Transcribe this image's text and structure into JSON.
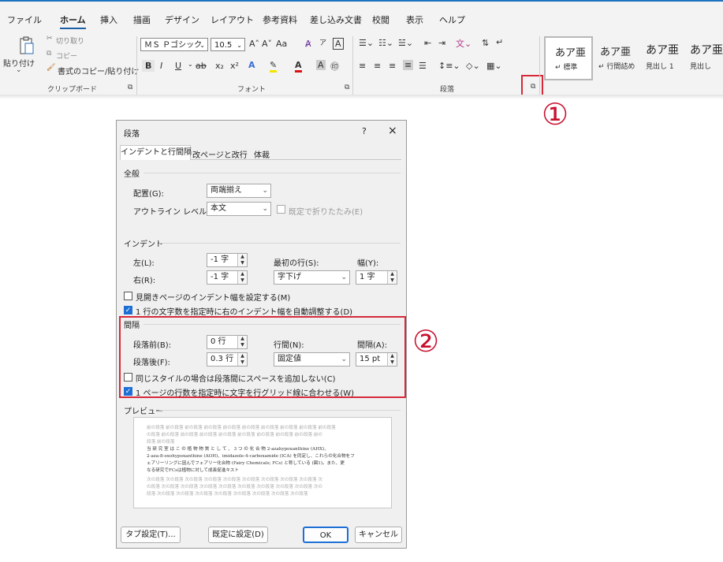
{
  "ribbon": {
    "tabs": [
      "ファイル",
      "ホーム",
      "挿入",
      "描画",
      "デザイン",
      "レイアウト",
      "参考資料",
      "差し込み文書",
      "校閲",
      "表示",
      "ヘルプ"
    ],
    "active_tab": "ホーム",
    "clipboard": {
      "paste": "貼り付け",
      "cut": "切り取り",
      "copy": "コピー",
      "format_painter": "書式のコピー/貼り付け",
      "group": "クリップボード"
    },
    "font": {
      "name": "ＭＳ Ｐゴシック",
      "size": "10.5",
      "group": "フォント",
      "aa": "Aa",
      "bold": "B",
      "italic": "I",
      "underline": "U",
      "strike": "ab",
      "sub": "x₂",
      "sup": "x²"
    },
    "paragraph": {
      "group": "段落"
    },
    "styles": [
      {
        "sample": "あア亜",
        "name": "↵ 標準"
      },
      {
        "sample": "あア亜",
        "name": "↵ 行間詰め"
      },
      {
        "sample": "あア亜",
        "name": "見出し 1"
      },
      {
        "sample": "あア亜",
        "name": "見出し"
      }
    ]
  },
  "callouts": {
    "one": "①",
    "two": "②"
  },
  "dialog": {
    "title": "段落",
    "help": "?",
    "close": "×",
    "tabs": [
      "インデントと行間隔",
      "改ページと改行",
      "体裁"
    ],
    "general": {
      "heading": "全般",
      "alignment_label": "配置(G):",
      "alignment_value": "両端揃え",
      "outline_label": "アウトライン レベル(O):",
      "outline_value": "本文",
      "collapse_label": "既定で折りたたみ(E)"
    },
    "indent": {
      "heading": "インデント",
      "left_label": "左(L):",
      "left_value": "-1 字",
      "right_label": "右(R):",
      "right_value": "-1 字",
      "first_line_label": "最初の行(S):",
      "first_line_value": "字下げ",
      "width_label": "幅(Y):",
      "width_value": "1 字",
      "mirror_label": "見開きページのインデント幅を設定する(M)",
      "auto_adjust_label": "1 行の文字数を指定時に右のインデント幅を自動調整する(D)"
    },
    "spacing": {
      "heading": "間隔",
      "before_label": "段落前(B):",
      "before_value": "0 行",
      "after_label": "段落後(F):",
      "after_value": "0.3 行",
      "line_label": "行間(N):",
      "line_value": "固定値",
      "at_label": "間隔(A):",
      "at_value": "15 pt",
      "no_space_label": "同じスタイルの場合は段落間にスペースを追加しない(C)",
      "snap_grid_label": "1 ページの行数を指定時に文字を行グリッド線に合わせる(W)"
    },
    "preview": {
      "heading": "プレビュー",
      "lines_prev": [
        "前の段落 前の段落 前の段落 前の段落 前の段落 前の段落 前の段落 前の段落 前の段落 前の段落",
        "の段落 前の段落 前の段落 前の段落 前の段落 前の段落 前の段落 前の段落 前の段落 前の",
        "段落 前の段落"
      ],
      "lines_current": [
        "当 研 究 室 は こ の 植 物 物 質 と し て 、 3 つ の 化 合 物 2-azahypoxanthine (AHX)、",
        "2-aza-8-oxohypoxanthine (AOH)、imidazole-4-carboxamide (ICA) を同定し、これらの化合物をフ",
        "ェアリーリングに因んでフェアリー化合物 (Fairy Chemicals; FCs) と称している (図1)。また、更",
        "なる研究でFCsは植物に対して成長促進キスト"
      ],
      "lines_next": [
        "次の段落 次の段落 次の段落 次の段落 次の段落 次の段落 次の段落 次の段落 次の段落 次",
        "の段落 次の段落 次の段落 次の段落 次の段落 次の段落 次の段落 次の段落 次の段落 次の",
        "段落 次の段落 次の段落 次の段落 次の段落 次の段落 次の段落 次の段落 次の段落"
      ]
    },
    "buttons": {
      "tabs": "タブ設定(T)...",
      "default": "既定に設定(D)",
      "ok": "OK",
      "cancel": "キャンセル"
    }
  }
}
